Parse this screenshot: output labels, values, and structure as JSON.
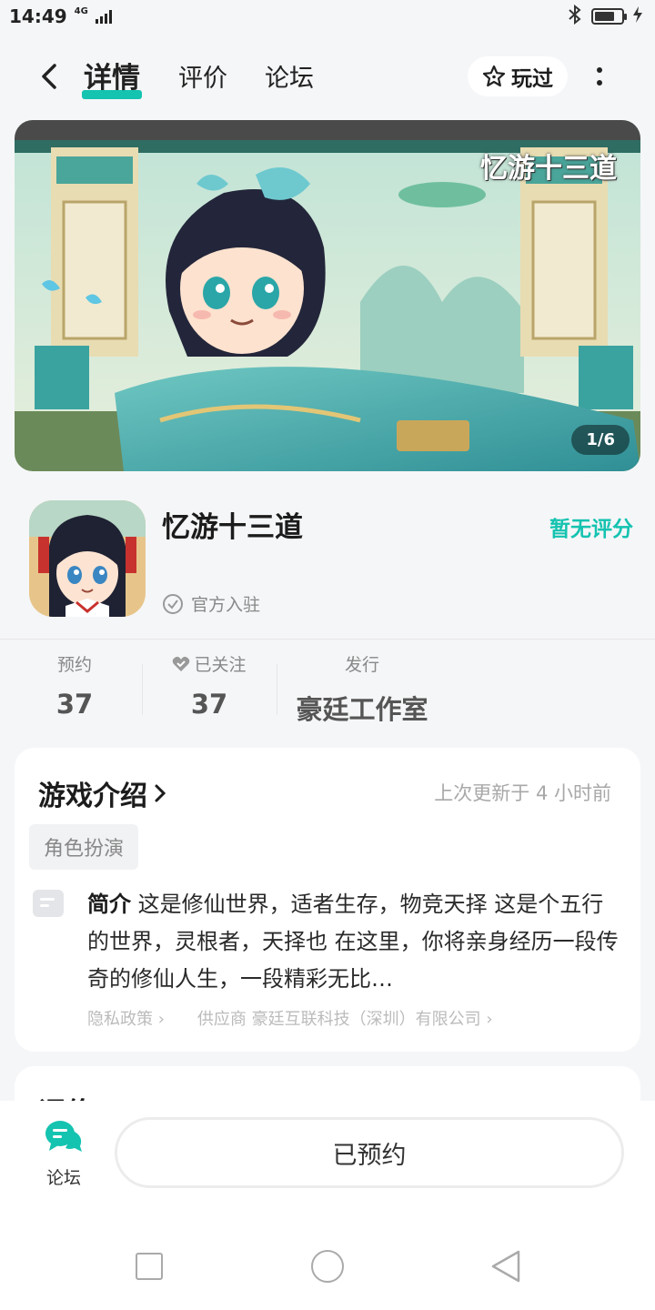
{
  "status": {
    "time": "14:49",
    "network": "4G",
    "battery_level": 0.75
  },
  "nav": {
    "tabs": [
      {
        "label": "详情",
        "active": true
      },
      {
        "label": "评价",
        "active": false
      },
      {
        "label": "论坛",
        "active": false
      }
    ],
    "played_label": "玩过"
  },
  "banner": {
    "counter": "1/6",
    "logo_text": "忆游十三道"
  },
  "app": {
    "name": "忆游十三道",
    "rating": "暂无评分",
    "official": "官方入驻"
  },
  "stats": {
    "reserve_label": "预约",
    "reserve_value": "37",
    "follow_label": "已关注",
    "follow_value": "37",
    "publisher_label": "发行",
    "publisher_value": "豪廷工作室"
  },
  "intro": {
    "title": "游戏介绍",
    "updated": "上次更新于 4 小时前",
    "tag": "角色扮演",
    "desc_label": "简介",
    "desc_text": "这是修仙世界，适者生存，物竞天择 这是个五行的世界，灵根者，天择也 在这里，你将亲身经历一段传奇的修仙人生，一段精彩无比…",
    "privacy": "隐私政策",
    "supplier": "供应商 豪廷互联科技（深圳）有限公司"
  },
  "review": {
    "title": "评价"
  },
  "bottom": {
    "forum_label": "论坛",
    "reserve_button": "已预约"
  },
  "colors": {
    "accent": "#14c3b0",
    "background": "#f5f6f8"
  }
}
